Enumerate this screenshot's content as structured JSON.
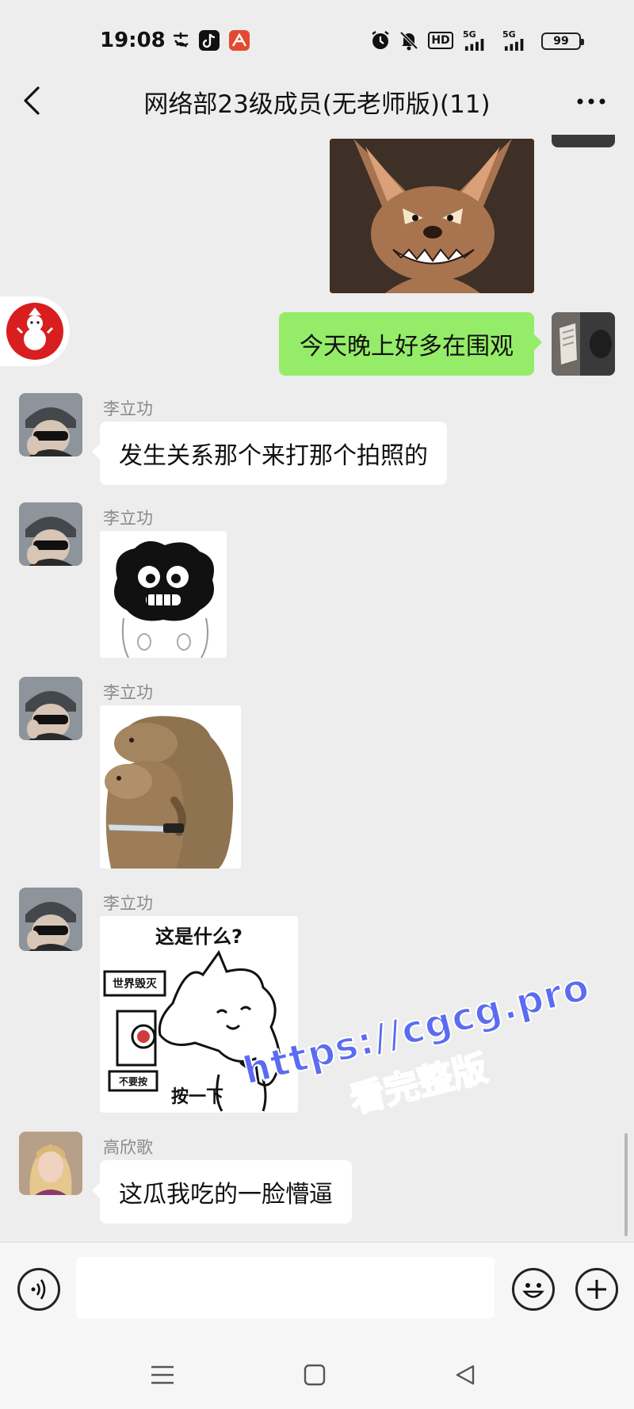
{
  "status_bar": {
    "time": "19:08",
    "icons": [
      "alipay-icon",
      "tiktok-icon",
      "app-icon",
      "alarm-icon",
      "mute-icon",
      "hd-icon",
      "signal-5g-icon",
      "signal-5g-icon"
    ],
    "network_1": "5G",
    "network_2": "5G",
    "hd": "HD",
    "battery": "99"
  },
  "header": {
    "title": "网络部23级成员(无老师版)(11)",
    "back_icon": "chevron-left-icon",
    "more_icon": "more-icon"
  },
  "messages": [
    {
      "type": "image",
      "from": "self",
      "sticker": "jerry-mouse-grin-sticker"
    },
    {
      "type": "text",
      "from": "self",
      "text": "今天晚上好多在围观"
    },
    {
      "type": "text",
      "from": "other",
      "sender": "李立功",
      "text": "发生关系那个来打那个拍照的"
    },
    {
      "type": "image",
      "from": "other",
      "sender": "李立功",
      "sticker": "black-blob-face-sticker"
    },
    {
      "type": "image",
      "from": "other",
      "sender": "李立功",
      "sticker": "capybara-knife-sticker"
    },
    {
      "type": "image",
      "from": "other",
      "sender": "李立功",
      "sticker": "cat-button-sticker",
      "sticker_text": {
        "question": "这是什么?",
        "top_label": "世界毁灭",
        "bottom_label": "不要按",
        "caption": "按一下"
      }
    },
    {
      "type": "text",
      "from": "other",
      "sender": "高欣歌",
      "text": "这瓜我吃的一脸懵逼"
    }
  ],
  "watermark": {
    "url": "https://cgcg.pro",
    "cta": "看完整版"
  },
  "input_bar": {
    "placeholder": "",
    "voice_icon": "voice-icon",
    "emoji_icon": "emoji-icon",
    "plus_icon": "plus-icon"
  },
  "colors": {
    "background": "#ededed",
    "green_bubble": "#95ec69",
    "white_bubble": "#ffffff",
    "watermark": "#5b6cf0"
  }
}
